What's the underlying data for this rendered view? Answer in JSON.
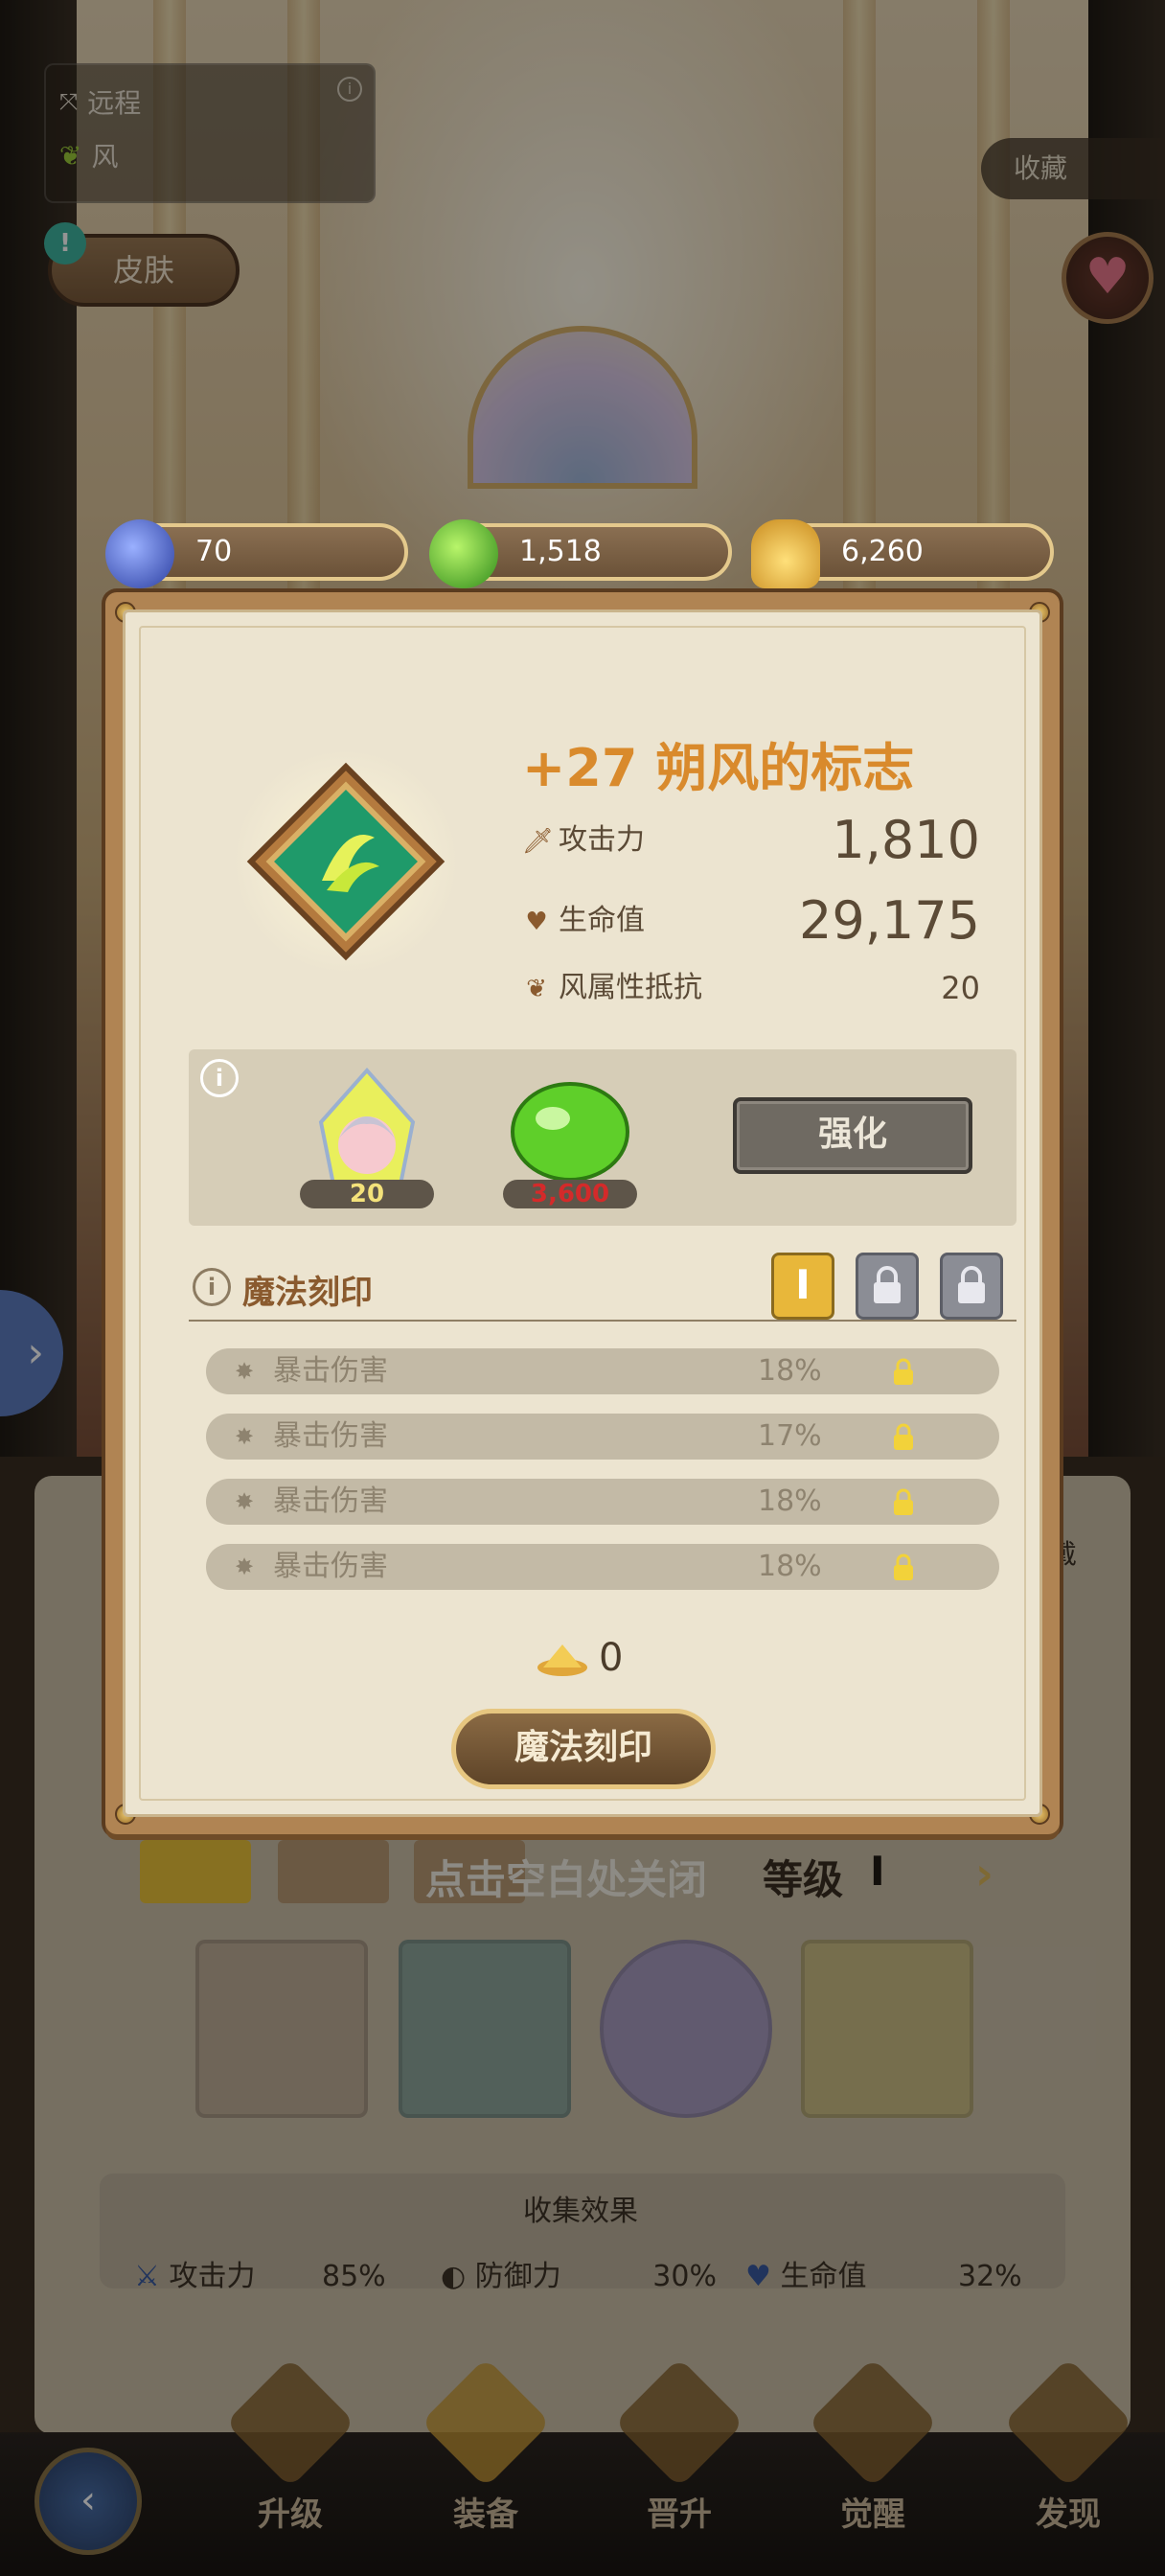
{
  "attributes": {
    "type": "远程",
    "element": "风"
  },
  "skin_label": "皮肤",
  "collect_label": "收藏",
  "currencies": [
    {
      "icon": "blue-crystal-icon",
      "value": "70"
    },
    {
      "icon": "green-orb-icon",
      "value": "1,518"
    },
    {
      "icon": "gold-pile-icon",
      "value": "6,260"
    }
  ],
  "item": {
    "title": "+27 朔风的标志",
    "stats": [
      {
        "icon": "sword-icon",
        "label": "攻击力",
        "value": "1,810"
      },
      {
        "icon": "heart-shield-icon",
        "label": "生命值",
        "value": "29,175"
      },
      {
        "icon": "wind-leaf-icon",
        "label": "风属性抵抗",
        "value": "20"
      }
    ]
  },
  "upgrade": {
    "materials": [
      {
        "icon": "hero-portrait-icon",
        "count": "20"
      },
      {
        "icon": "green-orb-icon",
        "count": "3,600"
      }
    ],
    "button": "强化"
  },
  "rune": {
    "title": "魔法刻印",
    "slot_active_label": "I",
    "effects": [
      {
        "label": "暴击伤害",
        "value": "18%"
      },
      {
        "label": "暴击伤害",
        "value": "17%"
      },
      {
        "label": "暴击伤害",
        "value": "18%"
      },
      {
        "label": "暴击伤害",
        "value": "18%"
      }
    ],
    "cost": "0",
    "button": "魔法刻印"
  },
  "close_hint": "点击空白处关闭",
  "level_label": "等级",
  "level_value": "I",
  "right_side_label": "戴",
  "collection": {
    "title": "收集效果",
    "stats": [
      {
        "label": "攻击力",
        "value": "85%"
      },
      {
        "label": "防御力",
        "value": "30%"
      },
      {
        "label": "生命值",
        "value": "32%"
      }
    ]
  },
  "nav": [
    "升级",
    "装备",
    "晋升",
    "觉醒",
    "发现"
  ],
  "colors": {
    "accent_title": "#d98a2c",
    "frame": "#b08453",
    "insufficient": "#d42a2a"
  }
}
